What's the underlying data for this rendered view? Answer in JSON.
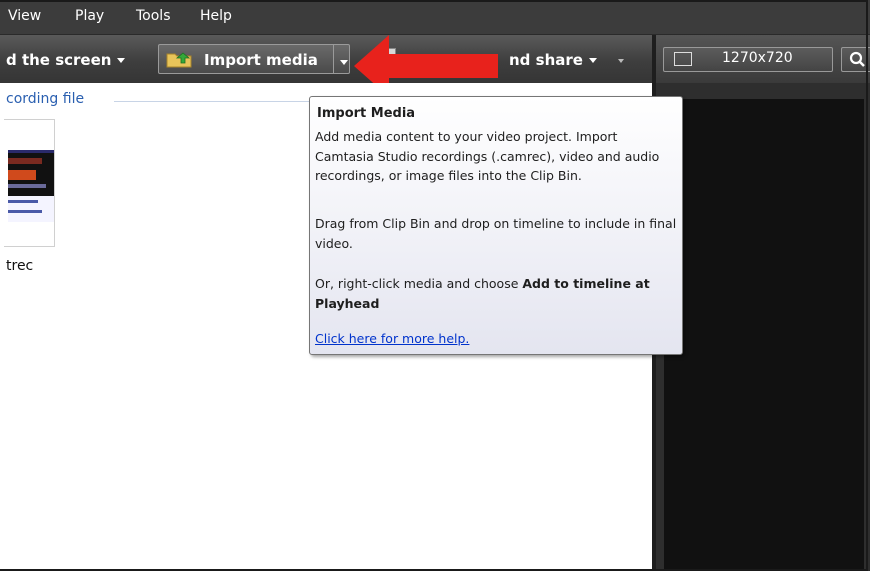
{
  "menu": {
    "items": [
      "View",
      "Play",
      "Tools",
      "Help"
    ]
  },
  "toolbar": {
    "record_label": "d the screen",
    "import_label": "Import media",
    "produce_label": "nd share",
    "produce_prefix_hidden": "Produce and share"
  },
  "clip_bin": {
    "group_label": "cording file",
    "clip_name": "trec"
  },
  "preview": {
    "dimensions": "1270x720"
  },
  "tooltip": {
    "title": "Import Media",
    "para1": "Add media content to your video project.  Import Camtasia Studio recordings (.camrec), video and audio recordings, or image files into the Clip Bin.",
    "para2": "Drag from Clip Bin and drop on timeline to include in final video.",
    "para3_prefix": "Or, right-click media and choose ",
    "para3_bold": "Add to timeline at Playhead",
    "link": "Click here for more help."
  },
  "colors": {
    "menubar": "#3c3c3c",
    "annotation_arrow": "#e8221c",
    "link": "#0033cc"
  },
  "icons": [
    "folder-import-icon",
    "produce-icon",
    "resize-icon",
    "search-icon",
    "red-arrow-annotation"
  ]
}
